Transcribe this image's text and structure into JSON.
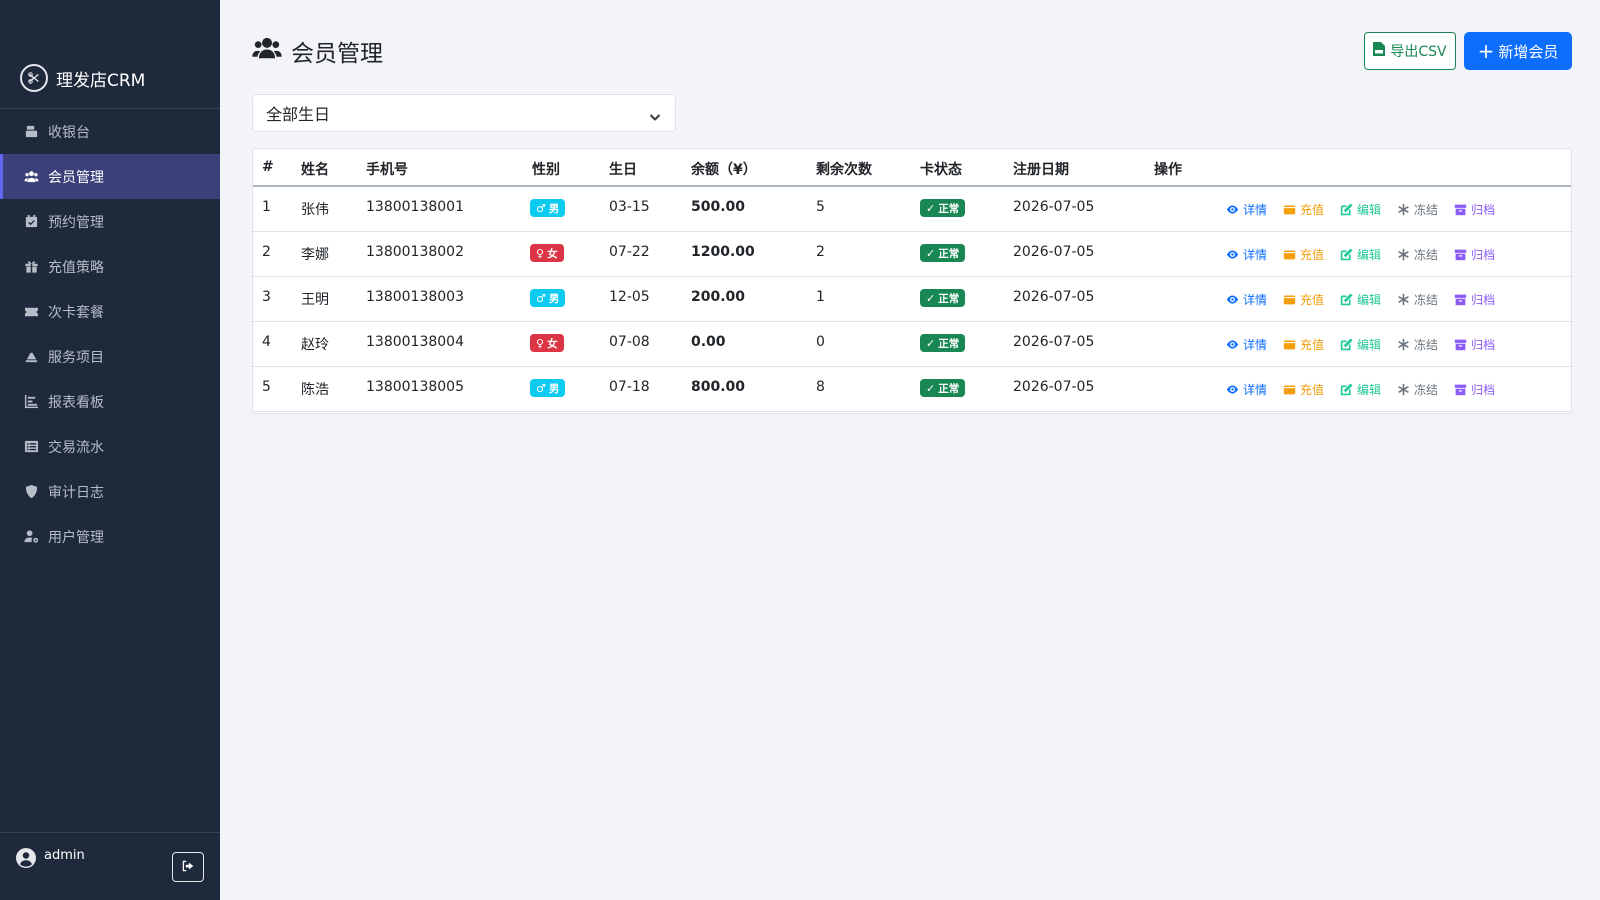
{
  "sidebar": {
    "brand": "理发店CRM",
    "items": [
      {
        "label": "收银台",
        "icon": "cash-register-icon"
      },
      {
        "label": "会员管理",
        "icon": "users-icon",
        "active": true
      },
      {
        "label": "预约管理",
        "icon": "calendar-check-icon"
      },
      {
        "label": "充值策略",
        "icon": "gift-icon"
      },
      {
        "label": "次卡套餐",
        "icon": "ticket-icon"
      },
      {
        "label": "服务项目",
        "icon": "service-icon"
      },
      {
        "label": "报表看板",
        "icon": "bar-chart-icon"
      },
      {
        "label": "交易流水",
        "icon": "list-icon"
      },
      {
        "label": "审计日志",
        "icon": "shield-icon"
      },
      {
        "label": "用户管理",
        "icon": "user-gear-icon"
      }
    ],
    "user": {
      "name": "admin"
    }
  },
  "header": {
    "title": "会员管理",
    "export_label": "导出CSV",
    "add_label": "新增会员"
  },
  "filter": {
    "selected": "全部生日"
  },
  "table": {
    "columns": [
      "#",
      "姓名",
      "手机号",
      "性别",
      "生日",
      "余额（¥）",
      "剩余次数",
      "卡状态",
      "注册日期",
      "操作"
    ],
    "rows": [
      {
        "no": "1",
        "name": "张伟",
        "phone": "13800138001",
        "gender": "男",
        "gender_type": "male",
        "birthday": "03-15",
        "balance": "500.00",
        "remaining": "5",
        "status": "正常",
        "registered": "2026-07-05"
      },
      {
        "no": "2",
        "name": "李娜",
        "phone": "13800138002",
        "gender": "女",
        "gender_type": "female",
        "birthday": "07-22",
        "balance": "1200.00",
        "remaining": "2",
        "status": "正常",
        "registered": "2026-07-05"
      },
      {
        "no": "3",
        "name": "王明",
        "phone": "13800138003",
        "gender": "男",
        "gender_type": "male",
        "birthday": "12-05",
        "balance": "200.00",
        "remaining": "1",
        "status": "正常",
        "registered": "2026-07-05"
      },
      {
        "no": "4",
        "name": "赵玲",
        "phone": "13800138004",
        "gender": "女",
        "gender_type": "female",
        "birthday": "07-08",
        "balance": "0.00",
        "remaining": "0",
        "status": "正常",
        "registered": "2026-07-05"
      },
      {
        "no": "5",
        "name": "陈浩",
        "phone": "13800138005",
        "gender": "男",
        "gender_type": "male",
        "birthday": "07-18",
        "balance": "800.00",
        "remaining": "8",
        "status": "正常",
        "registered": "2026-07-05"
      }
    ],
    "actions": {
      "view": "详情",
      "recharge": "充值",
      "edit": "编辑",
      "freeze": "冻结",
      "archive": "归档"
    }
  },
  "colors": {
    "sidebar_bg": "#1e293b",
    "active_item_bg": "#3b3f7a",
    "primary": "#0d6efd",
    "success": "#198754",
    "male_badge": "#0dcaf0",
    "female_badge": "#dc3545"
  }
}
